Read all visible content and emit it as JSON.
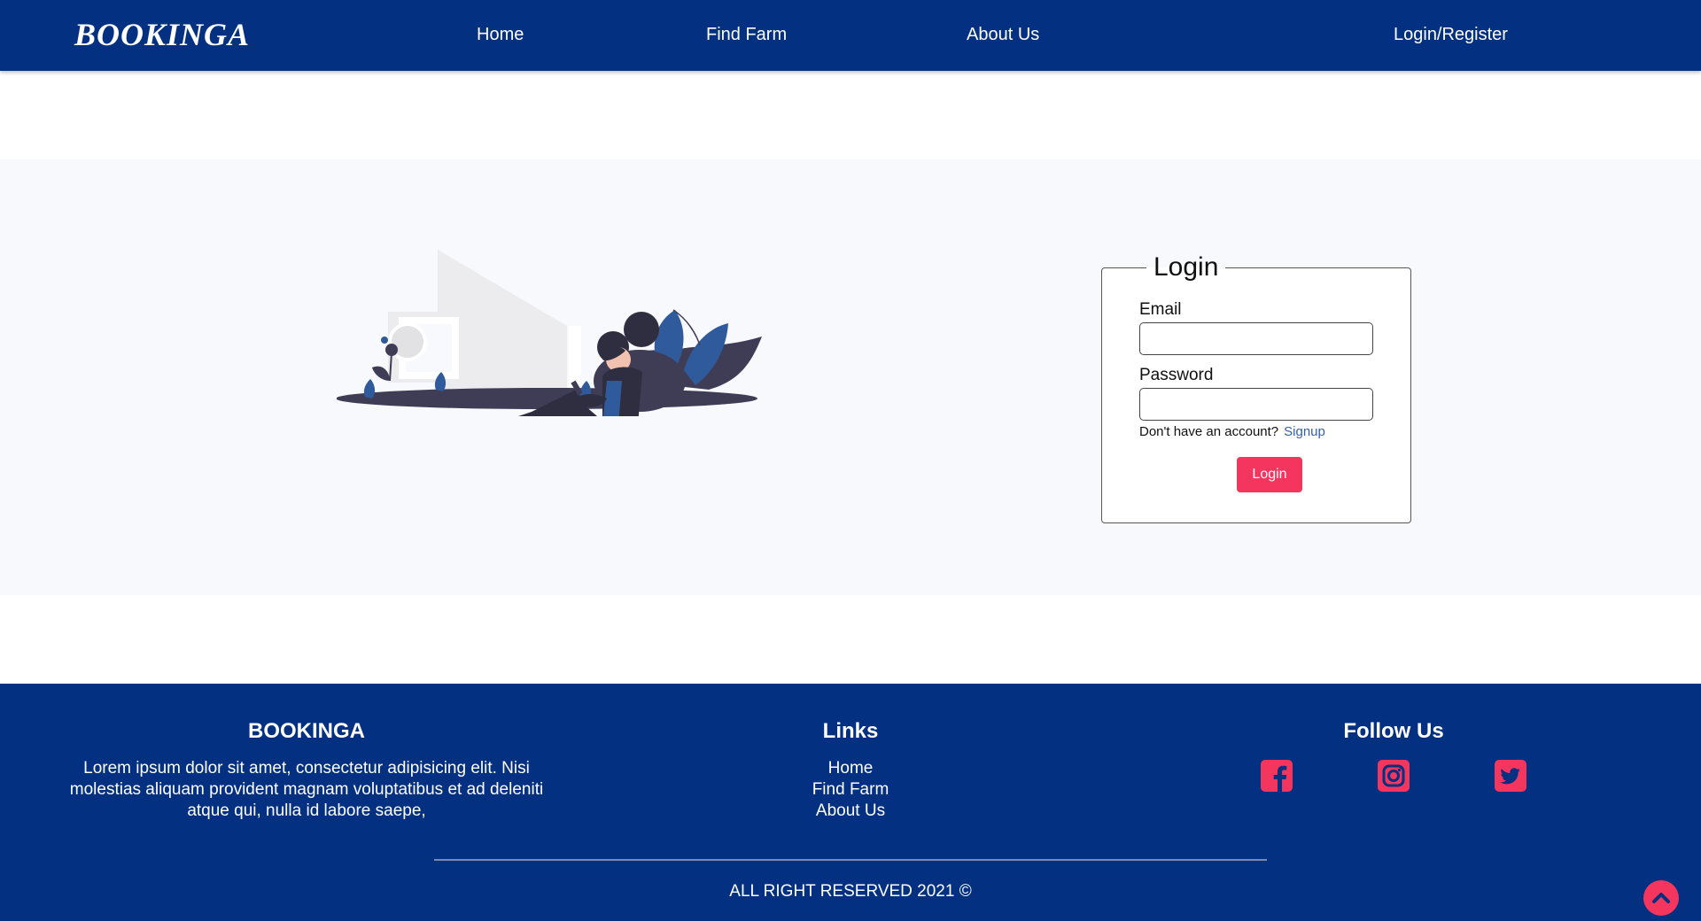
{
  "navbar": {
    "brand": "BOOKINGA",
    "links": [
      {
        "label": "Home"
      },
      {
        "label": "Find Farm"
      },
      {
        "label": "About Us"
      }
    ],
    "login_register": "Login/Register"
  },
  "login": {
    "legend": "Login",
    "email_label": "Email",
    "email_value": "",
    "password_label": "Password",
    "password_value": "",
    "no_account_text": "Don't have an account?",
    "signup_link": "Signup",
    "login_button": "Login"
  },
  "footer": {
    "brand_title": "BOOKINGA",
    "description": "Lorem ipsum dolor sit amet, consectetur adipisicing elit. Nisi molestias aliquam provident magnam voluptatibus et ad deleniti atque qui, nulla id labore saepe,",
    "links_title": "Links",
    "links": [
      {
        "label": "Home"
      },
      {
        "label": "Find Farm"
      },
      {
        "label": "About Us"
      }
    ],
    "follow_title": "Follow Us",
    "social": [
      {
        "icon": "facebook-icon"
      },
      {
        "icon": "instagram-icon"
      },
      {
        "icon": "twitter-icon"
      }
    ],
    "copyright": "ALL RIGHT RESERVED 2021 ©"
  },
  "colors": {
    "navy": "#033080",
    "accent": "#f4365f",
    "hero_bg": "#f8f9fd",
    "link_blue": "#3561a8"
  }
}
